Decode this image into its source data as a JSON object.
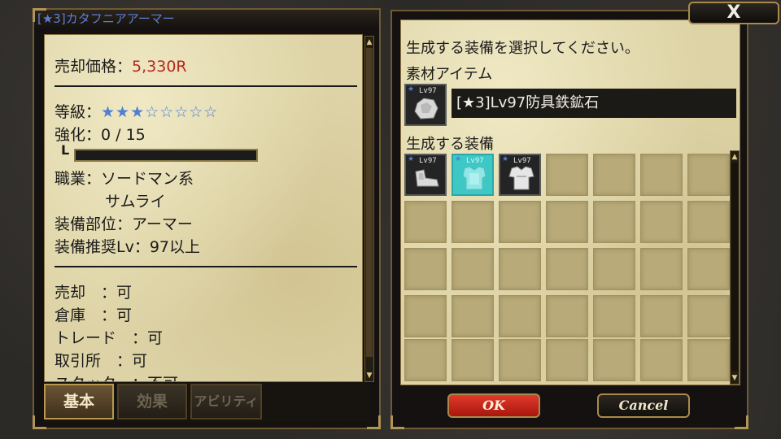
{
  "left_panel": {
    "title": "[★3]カタフニアアーマー",
    "price": {
      "label": "売却価格：",
      "value": "5,330R"
    },
    "grade": {
      "label": "等級：",
      "stars_filled": "★★★",
      "stars_empty": "☆☆☆☆☆"
    },
    "enhance": {
      "label": "強化：",
      "value": "0 / 15"
    },
    "job": {
      "label": "職業：",
      "value_line1": "ソードマン系",
      "value_line2": "サムライ"
    },
    "slot": {
      "label": "装備部位：",
      "value": "アーマー"
    },
    "level": {
      "label": "装備推奨Lv：",
      "value": "97以上"
    },
    "flags": [
      {
        "label": "売却　：",
        "value": "可"
      },
      {
        "label": "倉庫　：",
        "value": "可"
      },
      {
        "label": "トレード　：",
        "value": "可"
      },
      {
        "label": "取引所　：",
        "value": "可"
      },
      {
        "label": "スタック　：",
        "value": "不可"
      }
    ],
    "tabs": [
      {
        "label": "基本",
        "active": true
      },
      {
        "label": "効果",
        "active": false
      },
      {
        "label": "アビリティ",
        "active": false
      }
    ]
  },
  "right_panel": {
    "instruction": "生成する装備を選択してください。",
    "material_header": "素材アイテム",
    "material": {
      "level": "Lv97",
      "name": "[★3]Lv97防具鉄鉱石",
      "icon": "ore-icon"
    },
    "generated_header": "生成する装備",
    "generated_items": [
      {
        "level": "Lv97",
        "icon": "boots-icon",
        "selected": false
      },
      {
        "level": "Lv97",
        "icon": "armor-icon",
        "selected": true
      },
      {
        "level": "Lv97",
        "icon": "shirt-icon",
        "selected": false
      }
    ],
    "ok_label": "OK",
    "cancel_label": "Cancel"
  },
  "close_label": "X",
  "colors": {
    "price": "#b5281d",
    "star": "#4f7fd0",
    "title": "#5c7fd6",
    "selected_slot": "#3dc8c6",
    "ok_button": "#c82a1d"
  }
}
